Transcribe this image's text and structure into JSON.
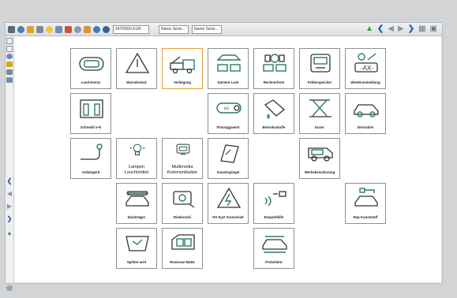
{
  "toolbar": {
    "field_value": "3470/500 EUR",
    "dropdown1": "Name Serie...",
    "dropdown2": "Name Serie..."
  },
  "tiles": [
    {
      "label": "Land-Kennz",
      "icon": "license-plate-icon"
    },
    {
      "label": "Warndreieck",
      "icon": "warning-triangle-icon"
    },
    {
      "label": "Verleigung",
      "icon": "tow-truck-icon",
      "selected": true
    },
    {
      "label": "Dament Lack",
      "icon": "car-paint-icon"
    },
    {
      "label": "Rechnerform",
      "icon": "axle-icon"
    },
    {
      "label": "Fehlerspeicher",
      "icon": "diagnostic-icon"
    },
    {
      "label": "Wiederanmeldung",
      "icon": "registration-icon"
    },
    {
      "label": "Schnelsf s+k",
      "icon": "seat-icon"
    },
    {
      "label": "Flüssiggasent",
      "icon": "gas-tank-icon"
    },
    {
      "label": "Betriebsstoffe",
      "icon": "oil-can-icon"
    },
    {
      "label": "Dozer",
      "icon": "car-lift-icon"
    },
    {
      "label": "Zerstrafen",
      "icon": "sedan-icon"
    },
    {
      "label": "Anhängerk",
      "icon": "tow-hitch-icon"
    },
    {
      "label": "Lampen\nLeuchtmittel",
      "icon": "lamp-icon",
      "big": true
    },
    {
      "label": "Multimedia\nKommunikation",
      "icon": "multimedia-icon",
      "big": true
    },
    {
      "label": "Zusatzspiegel",
      "icon": "mirror-icon"
    },
    {
      "label": "Werbebeschierung",
      "icon": "van-icon"
    },
    {
      "label": "Dachträger",
      "icon": "roof-rack-icon"
    },
    {
      "label": "Rinderschi",
      "icon": "navigation-icon"
    },
    {
      "label": "HV-Syst Sranschalt",
      "icon": "high-voltage-icon"
    },
    {
      "label": "Einparkhilfe",
      "icon": "parking-sensor-icon"
    },
    {
      "label": "Rep Kunststoff",
      "icon": "plastic-repair-icon"
    },
    {
      "label": "Spiltter weit",
      "icon": "windshield-icon"
    },
    {
      "label": "Reserase Matte",
      "icon": "floor-mat-icon"
    },
    {
      "label": "Probefahrt",
      "icon": "test-drive-icon"
    }
  ]
}
